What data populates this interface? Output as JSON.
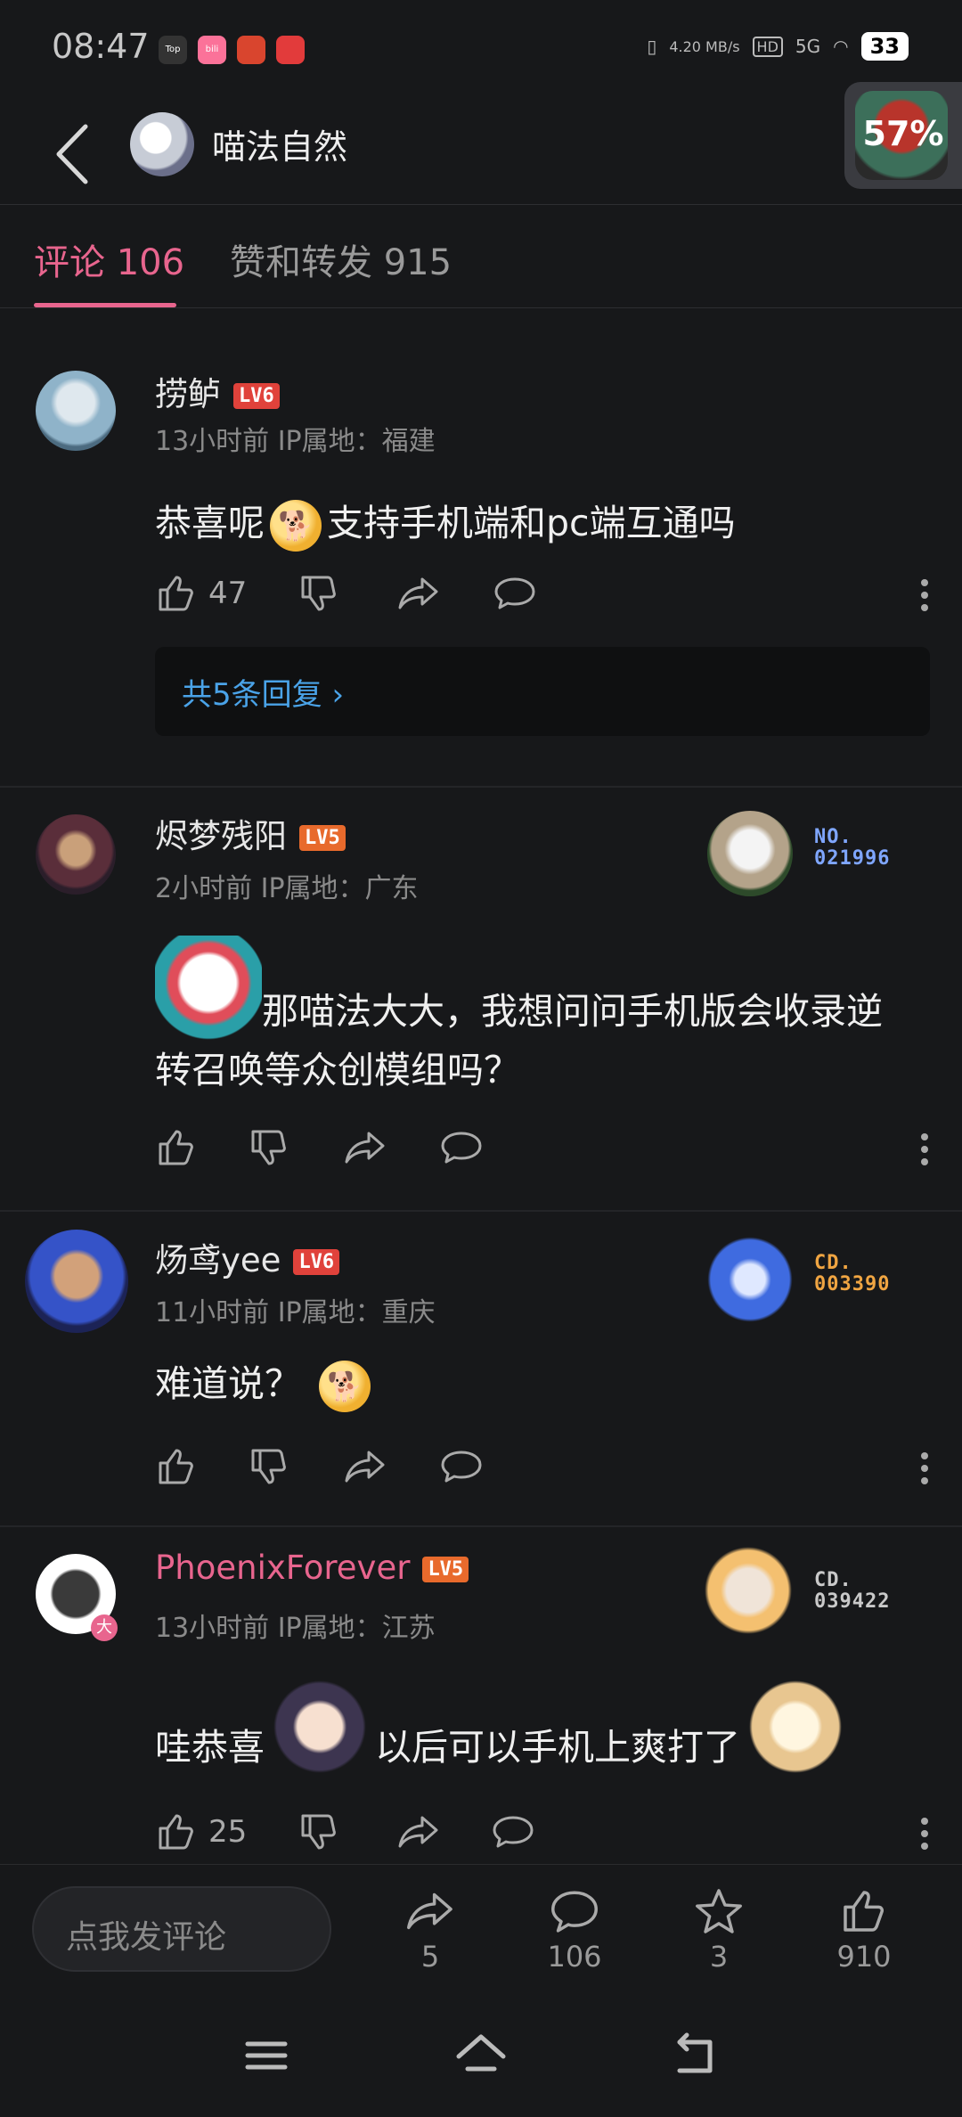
{
  "status_bar": {
    "time": "08:47",
    "net_speed": "4.20 MB/s",
    "network": "5G",
    "hd": "HD",
    "battery": "33",
    "app_badges": [
      "Top",
      "bili",
      "",
      ""
    ]
  },
  "header": {
    "title": "喵法自然",
    "float_percent": "57%"
  },
  "tabs": {
    "comments": "评论 106",
    "likes_shares": "赞和转发 915"
  },
  "comments": [
    {
      "username": "捞鲈",
      "level": "LV6",
      "meta": "13小时前 IP属地：福建",
      "text_before": "恭喜呢",
      "text_after": "支持手机端和pc端互通吗",
      "likes": "47",
      "replies": "共5条回复 ›"
    },
    {
      "username": "烬梦残阳",
      "level": "LV5",
      "meta": "2小时前 IP属地：广东",
      "text": "那喵法大大，我想问问手机版会收录逆转召唤等众创模组吗？",
      "badge_title": "NO.",
      "badge_number": "021996"
    },
    {
      "username": "炀鸢yee",
      "level": "LV6",
      "meta": "11小时前 IP属地：重庆",
      "text": "难道说？",
      "badge_title": "CD.",
      "badge_number": "003390"
    },
    {
      "username": "PhoenixForever",
      "level": "LV5",
      "meta": "13小时前 IP属地：江苏",
      "text_before": "哇恭喜",
      "text_after": "以后可以手机上爽打了",
      "likes": "25",
      "badge_title": "CD.",
      "badge_number": "039422",
      "avatar_tag": "大"
    }
  ],
  "bottom_bar": {
    "input_placeholder": "点我发评论",
    "share_count": "5",
    "comment_count": "106",
    "favorite_count": "3",
    "like_count": "910"
  },
  "colors": {
    "accent": "#e8658e",
    "background": "#17181a",
    "reply_link": "#4aa3e8"
  }
}
